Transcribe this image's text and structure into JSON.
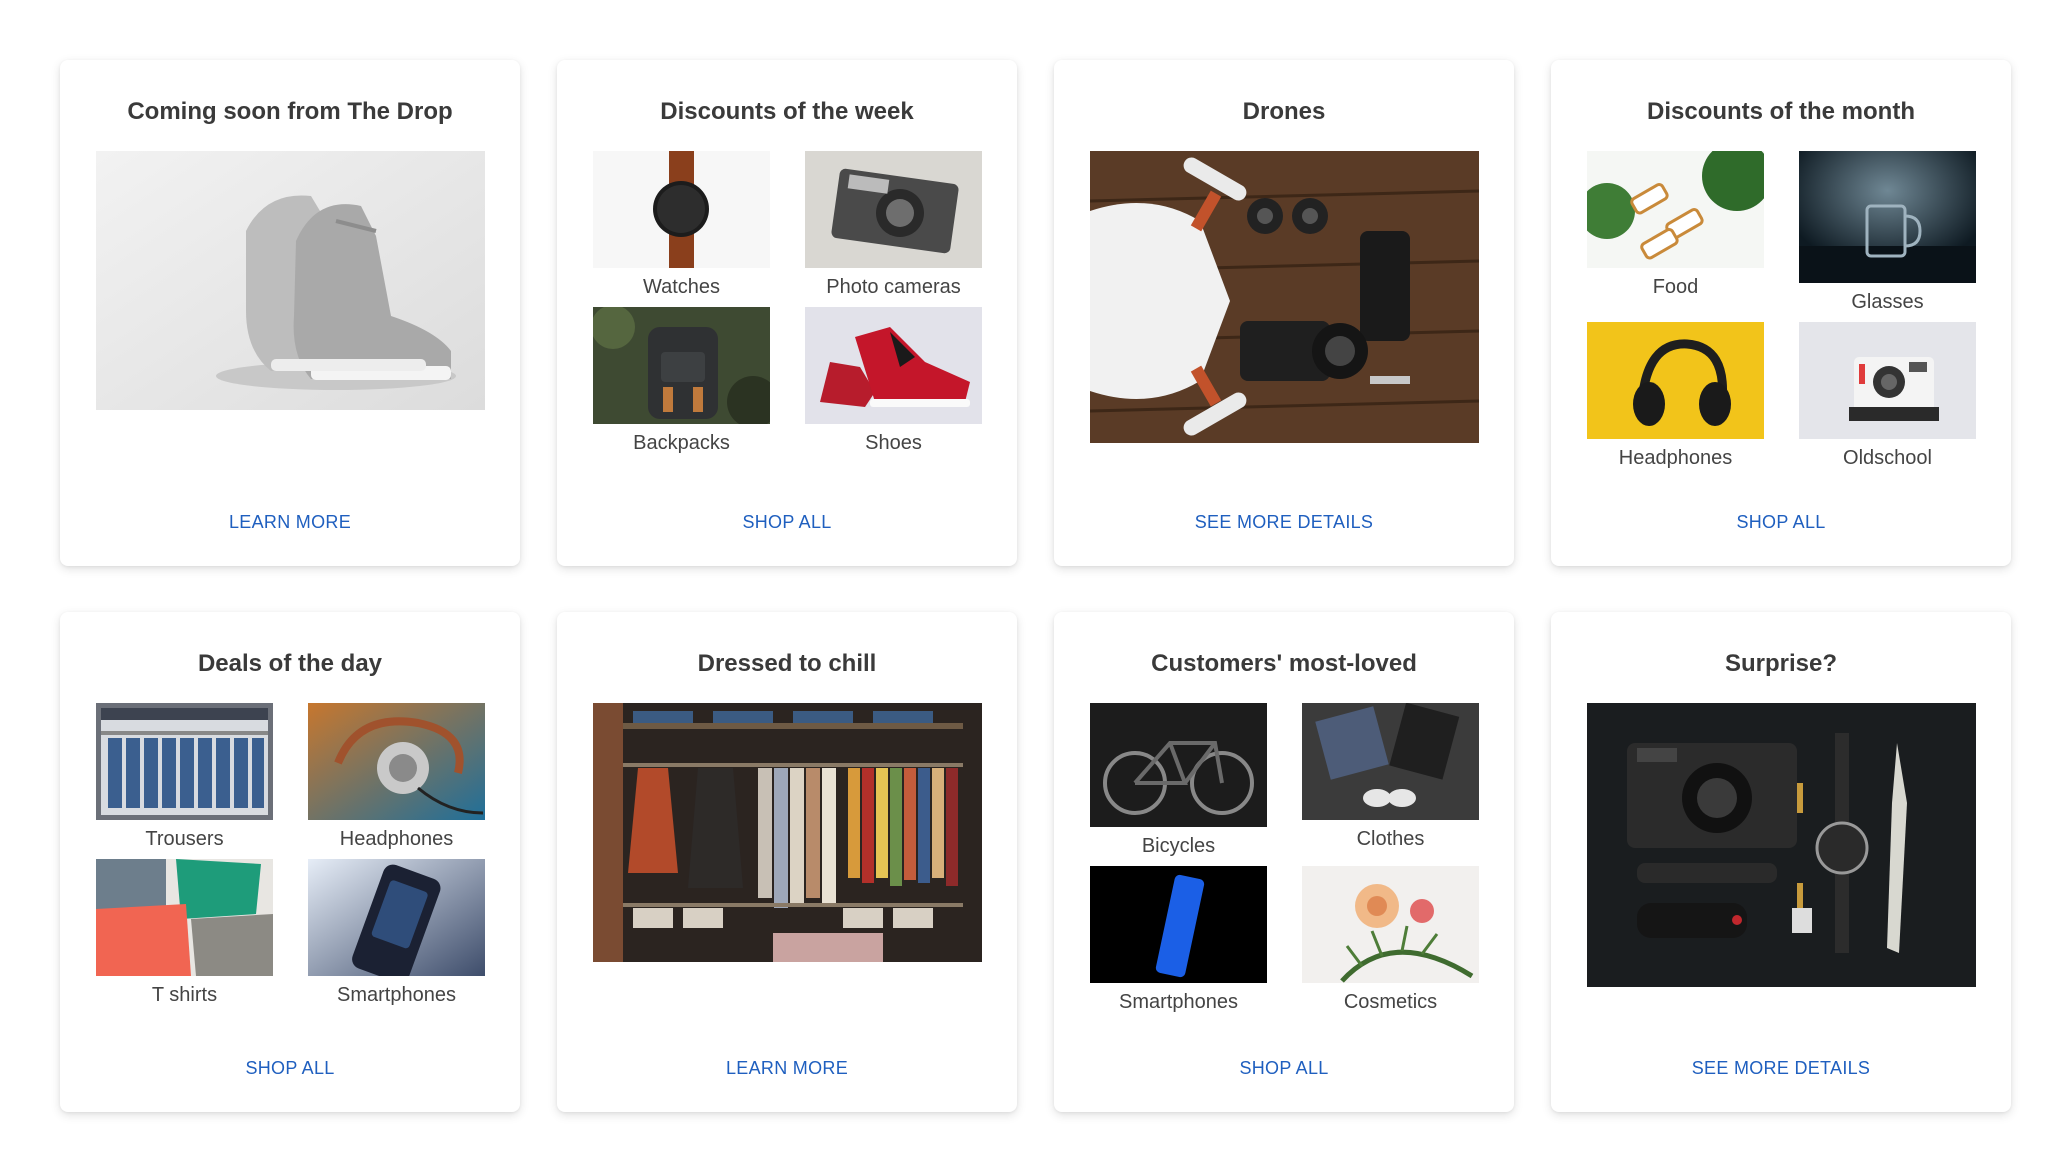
{
  "cards": [
    {
      "title": "Coming soon from The Drop",
      "link": "LEARN MORE",
      "image": "sneakers"
    },
    {
      "title": "Discounts of the week",
      "link": "SHOP ALL",
      "items": [
        {
          "label": "Watches",
          "icon": "watch"
        },
        {
          "label": "Photo cameras",
          "icon": "camera"
        },
        {
          "label": "Backpacks",
          "icon": "backpack"
        },
        {
          "label": "Shoes",
          "icon": "sneaker"
        }
      ]
    },
    {
      "title": "Drones",
      "link": "SEE MORE DETAILS",
      "image": "drone-flatlay"
    },
    {
      "title": "Discounts of the month",
      "link": "SHOP ALL",
      "items": [
        {
          "label": "Food",
          "icon": "food"
        },
        {
          "label": "Glasses",
          "icon": "glass-mug"
        },
        {
          "label": "Headphones",
          "icon": "headphones"
        },
        {
          "label": "Oldschool",
          "icon": "instant-camera"
        }
      ]
    },
    {
      "title": "Deals of the day",
      "link": "SHOP ALL",
      "items": [
        {
          "label": "Trousers",
          "icon": "jeans-shelf"
        },
        {
          "label": "Headphones",
          "icon": "headphones"
        },
        {
          "label": "T shirts",
          "icon": "polo-shirts"
        },
        {
          "label": "Smartphones",
          "icon": "smartphone"
        }
      ]
    },
    {
      "title": "Dressed to chill",
      "link": "LEARN MORE",
      "image": "wardrobe"
    },
    {
      "title": "Customers' most-loved",
      "link": "SHOP ALL",
      "items": [
        {
          "label": "Bicycles",
          "icon": "bicycle"
        },
        {
          "label": "Clothes",
          "icon": "clothes"
        },
        {
          "label": "Smartphones",
          "icon": "smartphone"
        },
        {
          "label": "Cosmetics",
          "icon": "cosmetics"
        }
      ]
    },
    {
      "title": "Surprise?",
      "link": "SEE MORE DETAILS",
      "image": "everyday-carry"
    }
  ],
  "colors": {
    "link": "#1f5fbf",
    "title": "#3a3a3a",
    "label": "#444444"
  }
}
